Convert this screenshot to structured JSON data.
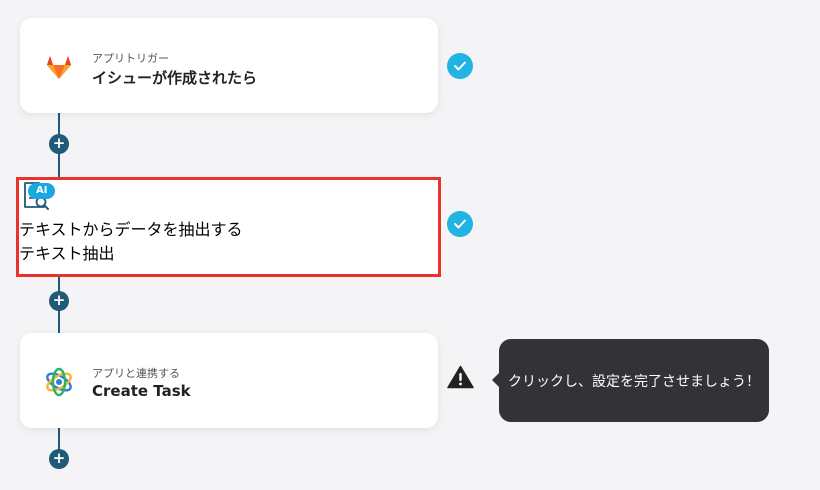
{
  "flow": {
    "steps": [
      {
        "subtitle": "アプリトリガー",
        "title": "イシューが作成されたら",
        "icon": "gitlab-icon",
        "status": "completed"
      },
      {
        "badge": "AI",
        "subtitle": "テキストからデータを抽出する",
        "title": "テキスト抽出",
        "icon": "document-search-icon",
        "status": "completed",
        "highlighted": true
      },
      {
        "subtitle": "アプリと連携する",
        "title": "Create Task",
        "icon": "app-logo-icon",
        "status": "warning"
      }
    ],
    "add_step_label": "+"
  },
  "tooltip": {
    "text": "クリックし、設定を完了させましょう！"
  },
  "colors": {
    "connector": "#1f5a78",
    "check": "#21b3e2",
    "highlight_border": "#e8322a",
    "tooltip_bg": "#333337",
    "ai_badge": "#1ba8e0"
  }
}
